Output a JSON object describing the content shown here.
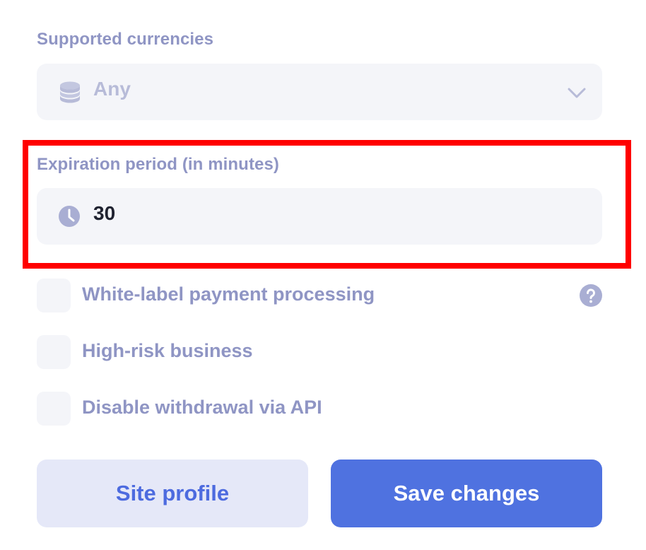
{
  "currencies": {
    "label": "Supported currencies",
    "value": "Any",
    "icon": "coins-stack-icon"
  },
  "expiration": {
    "label": "Expiration period (in minutes)",
    "value": "30",
    "icon": "clock-icon"
  },
  "options": {
    "white_label": {
      "label": "White-label payment processing",
      "checked": false
    },
    "high_risk": {
      "label": "High-risk business",
      "checked": false
    },
    "disable_withdrawal": {
      "label": "Disable withdrawal via API",
      "checked": false
    }
  },
  "buttons": {
    "site_profile": "Site profile",
    "save_changes": "Save changes"
  },
  "colors": {
    "label": "#8f95c4",
    "field_bg": "#f4f5f9",
    "primary": "#4f72e0",
    "secondary_bg": "#e5e8f8",
    "secondary_text": "#4d6bdf",
    "highlight": "#ff0000",
    "value_dark": "#1f2230",
    "value_muted": "#b7bbd8"
  }
}
